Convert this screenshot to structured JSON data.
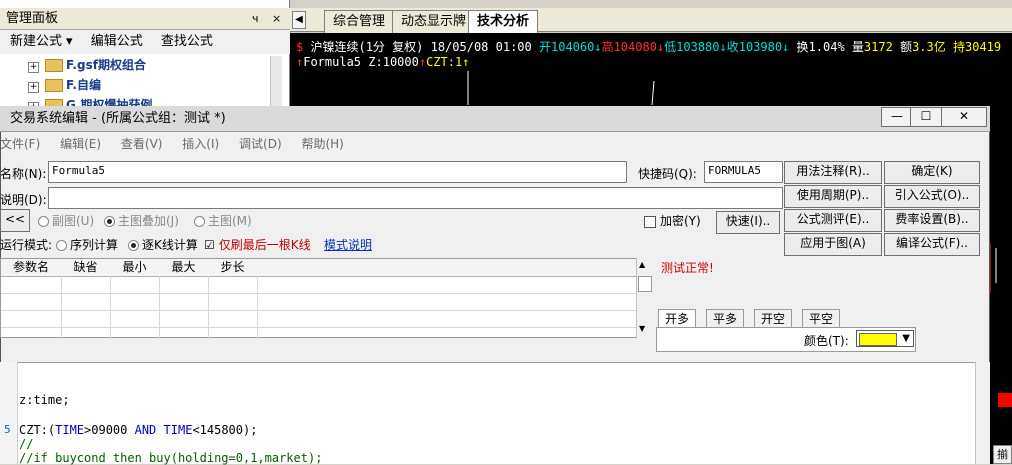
{
  "left_panel": {
    "title": "管理面板",
    "pin": "ч",
    "close": "×",
    "menu": [
      "新建公式",
      "编辑公式",
      "查找公式"
    ],
    "menu_arrow": "▾",
    "tree": [
      "F.gsf期权组合",
      "F.自编",
      "G.期权爆抽获例"
    ]
  },
  "tabs": {
    "back": "◀",
    "items": [
      "综合管理",
      "动态显示牌",
      "技术分析"
    ],
    "active_index": 2
  },
  "chart": {
    "info1": {
      "marker": "$",
      "name": "沪镍连续(1分 复权)",
      "datetime": "18/05/08 01:00",
      "open": "开104060↓",
      "high": "高104080↓",
      "low": "低103880↓",
      "close": "收103980↓",
      "turnover": "换1.04%",
      "volume_label": "量",
      "volume": "3172",
      "amount_label": "额",
      "amount": "3.3亿",
      "hold": "持30419"
    },
    "info2": {
      "arrow1": "↑",
      "formula": "Formula5",
      "z": "Z:10000",
      "arrow2": "↑",
      "czt": "CZT:1",
      "arrow3": "↑"
    }
  },
  "dialog": {
    "title": "交易系统编辑 - (所属公式组：测试 *)",
    "win_buttons": [
      "—",
      "☐",
      "✕"
    ],
    "menu": [
      "文件(F)",
      "编辑(E)",
      "查看(V)",
      "插入(I)",
      "调试(D)",
      "帮助(H)"
    ],
    "name_label": "名称(N):",
    "name_value": "Formula5",
    "desc_label": "说明(D):",
    "desc_value": "",
    "hotkey_label": "快捷码(Q):",
    "hotkey_value": "FORMULA5",
    "collapse_button": "<<",
    "subchart_options": [
      "副图(U)",
      "主图叠加(J)",
      "主图(M)"
    ],
    "subchart_selected": 1,
    "encrypt_label": "加密(Y)",
    "fast_button": "快速(I)..",
    "run_mode_label": "运行模式:",
    "run_modes": [
      "序列计算",
      "逐K线计算"
    ],
    "run_mode_selected": 1,
    "refresh_last_label": "仅刷最后一根K线",
    "refresh_last_checked": "☑",
    "mode_help_link": "模式说明",
    "buttons_col1": [
      "用法注释(R)..",
      "使用周期(P)..",
      "公式测评(E)..",
      "应用于图(A)"
    ],
    "buttons_col2": [
      "确定(K)",
      "引入公式(O)..",
      "费率设置(B)..",
      "编译公式(F).."
    ],
    "param_headers": [
      "参数名",
      "缺省",
      "最小",
      "最大",
      "步长"
    ],
    "status_text": "测试正常!",
    "signal_tabs": [
      "开多",
      "平多",
      "开空",
      "平空"
    ],
    "signal_tab_active": 0,
    "color_label": "颜色(T):",
    "color_value": "#ffff00",
    "code": {
      "line_number": "5",
      "line1": "z:time;",
      "line2_pre": "CZT:(",
      "line2_kw1": "TIME",
      "line2_mid1": ">09000 ",
      "line2_kw2": "AND",
      "line2_mid2": " ",
      "line2_kw3": "TIME",
      "line2_post": "<145800);",
      "line3": "//",
      "line4": "//if buycond then buy(holding=0,1,market);"
    }
  },
  "right_button": "揃"
}
